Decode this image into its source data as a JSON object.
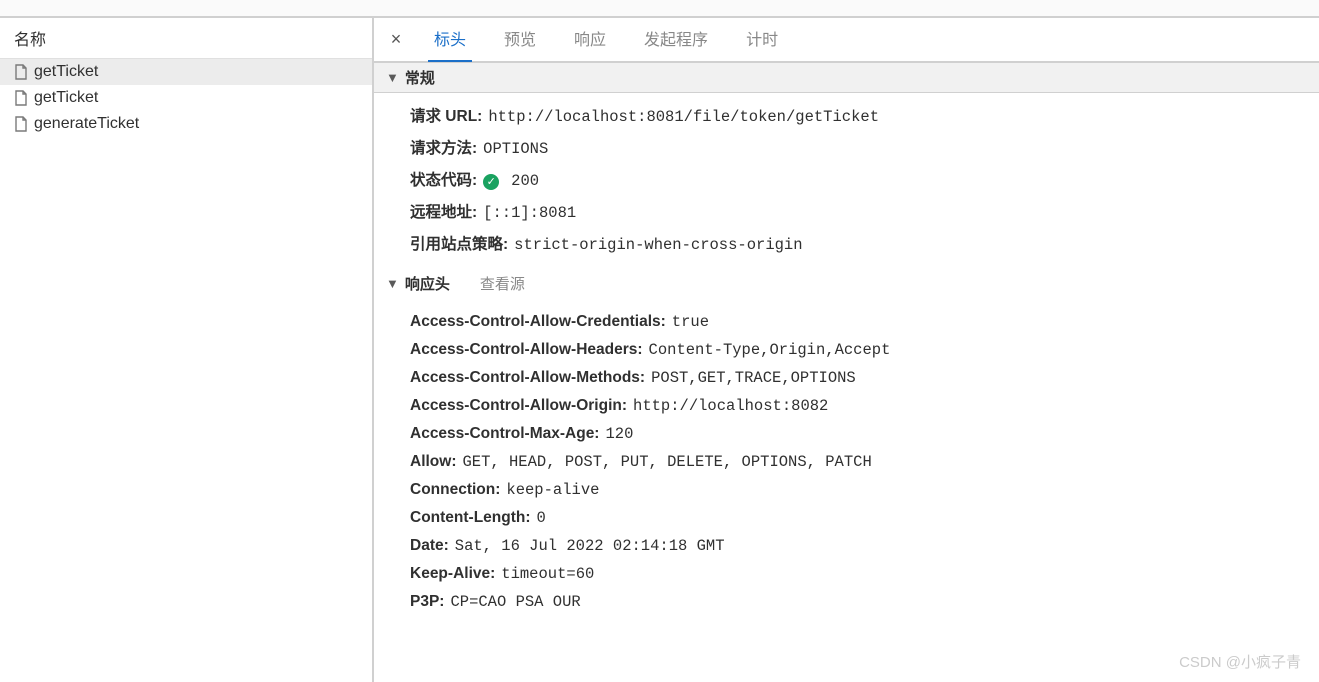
{
  "left": {
    "header": "名称",
    "items": [
      {
        "label": "getTicket",
        "selected": true
      },
      {
        "label": "getTicket",
        "selected": false
      },
      {
        "label": "generateTicket",
        "selected": false
      }
    ]
  },
  "tabs": {
    "close": "×",
    "items": [
      "标头",
      "预览",
      "响应",
      "发起程序",
      "计时"
    ],
    "activeIndex": 0
  },
  "general": {
    "title": "常规",
    "rows": [
      {
        "key": "请求 URL:",
        "val": "http://localhost:8081/file/token/getTicket",
        "status": false
      },
      {
        "key": "请求方法:",
        "val": "OPTIONS",
        "status": false
      },
      {
        "key": "状态代码:",
        "val": "200",
        "status": true
      },
      {
        "key": "远程地址:",
        "val": "[::1]:8081",
        "status": false
      },
      {
        "key": "引用站点策略:",
        "val": "strict-origin-when-cross-origin",
        "status": false
      }
    ]
  },
  "response_headers": {
    "title": "响应头",
    "view_source": "查看源",
    "rows": [
      {
        "key": "Access-Control-Allow-Credentials:",
        "val": "true"
      },
      {
        "key": "Access-Control-Allow-Headers:",
        "val": "Content-Type,Origin,Accept"
      },
      {
        "key": "Access-Control-Allow-Methods:",
        "val": "POST,GET,TRACE,OPTIONS"
      },
      {
        "key": "Access-Control-Allow-Origin:",
        "val": "http://localhost:8082"
      },
      {
        "key": "Access-Control-Max-Age:",
        "val": "120"
      },
      {
        "key": "Allow:",
        "val": "GET, HEAD, POST, PUT, DELETE, OPTIONS, PATCH"
      },
      {
        "key": "Connection:",
        "val": "keep-alive"
      },
      {
        "key": "Content-Length:",
        "val": "0"
      },
      {
        "key": "Date:",
        "val": "Sat, 16 Jul 2022 02:14:18 GMT"
      },
      {
        "key": "Keep-Alive:",
        "val": "timeout=60"
      },
      {
        "key": "P3P:",
        "val": "CP=CAO PSA OUR"
      }
    ]
  },
  "watermark": "CSDN @小疯子青"
}
